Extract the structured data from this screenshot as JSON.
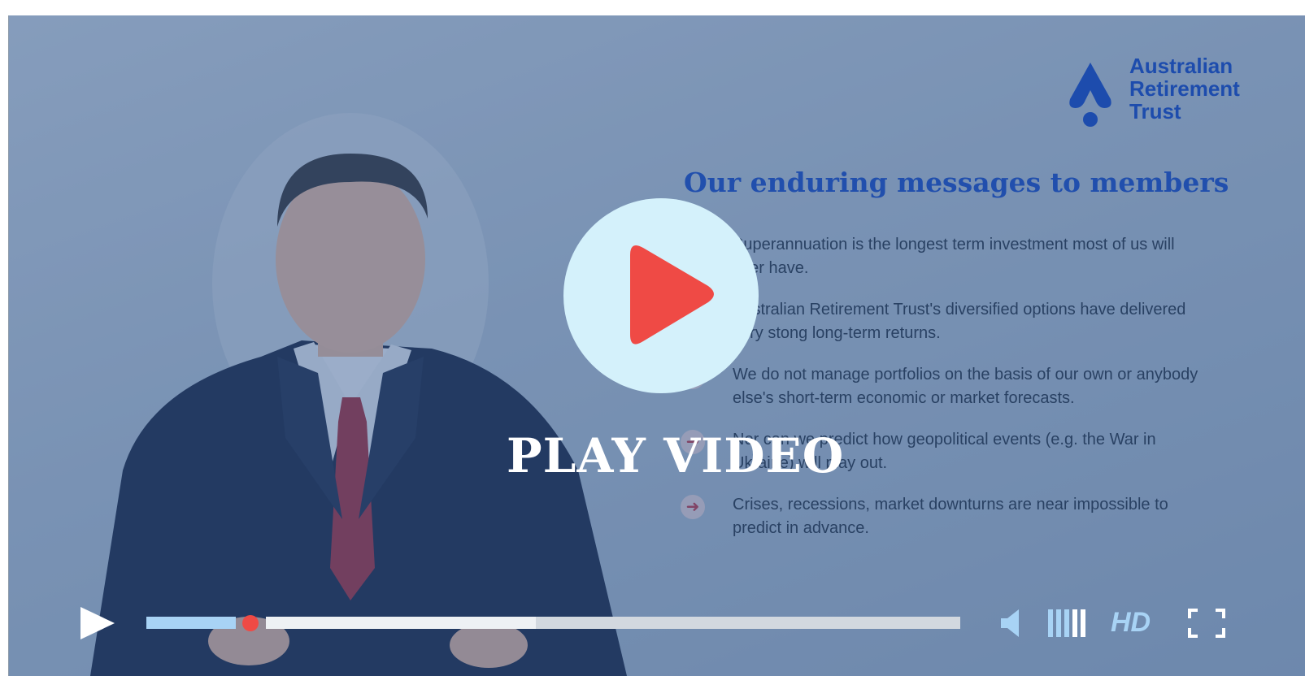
{
  "video": {
    "play_label": "PLAY VIDEO"
  },
  "slide": {
    "logo_lines": [
      "Australian",
      "Retirement",
      "Trust"
    ],
    "title": "Our enduring messages to members",
    "bullets": [
      "Superannuation is the longest term investment most of us will ever have.",
      "Australian Retirement Trust's diversified options have delivered very stong long-term returns.",
      "We do not manage portfolios on the basis of our own or anybody else's short-term economic or market forecasts.",
      "Nor can we predict how geopolitical events (e.g. the War in Ukraine) will play out.",
      "Crises, recessions, market downturns are near impossible to predict in advance."
    ]
  },
  "controls": {
    "hd_label": "HD",
    "progress_fraction": 0.13,
    "buffered_fraction": 0.47,
    "icons": {
      "play": "play-icon",
      "volume": "volume-icon",
      "volume_levels": "volume-level-icon",
      "fullscreen": "fullscreen-icon"
    }
  },
  "colors": {
    "accent_red": "#ef4a45",
    "accent_light_blue": "#a8d3f5",
    "play_circle": "#d4f1fb",
    "brand_blue": "#1c4fc4"
  }
}
